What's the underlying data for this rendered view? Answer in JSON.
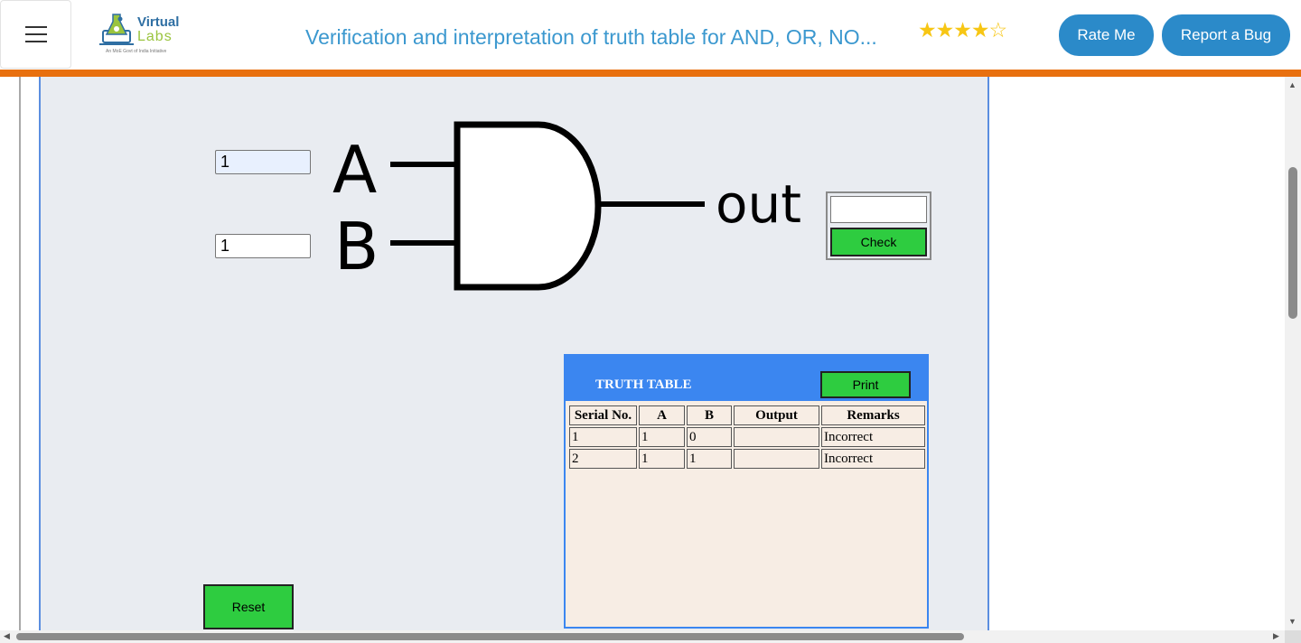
{
  "header": {
    "logo": {
      "word1": "Virtual",
      "word2": "Labs",
      "tagline": "An MoE Govt of India Initiative"
    },
    "title": "Verification and interpretation of truth table for AND, OR, NO...",
    "rating": {
      "filled": 4,
      "total": 5,
      "filled_glyphs": "★★★★",
      "empty_glyphs": "☆"
    },
    "rate_label": "Rate Me",
    "bug_label": "Report a Bug"
  },
  "colors": {
    "accent": "#2b8ac9",
    "orange_bar": "#e8700f",
    "button_green": "#2ecc40",
    "panel_blue": "#3b86f0"
  },
  "simulator": {
    "input_a": "1",
    "input_b": "1",
    "label_a": "A",
    "label_b": "B",
    "label_out": "out",
    "output_value": "",
    "check_label": "Check",
    "reset_label": "Reset"
  },
  "truth_table": {
    "title": "TRUTH TABLE",
    "print_label": "Print",
    "columns": [
      "Serial No.",
      "A",
      "B",
      "Output",
      "Remarks"
    ],
    "rows": [
      [
        "1",
        "1",
        "0",
        "",
        "Incorrect"
      ],
      [
        "2",
        "1",
        "1",
        "",
        "Incorrect"
      ]
    ]
  }
}
